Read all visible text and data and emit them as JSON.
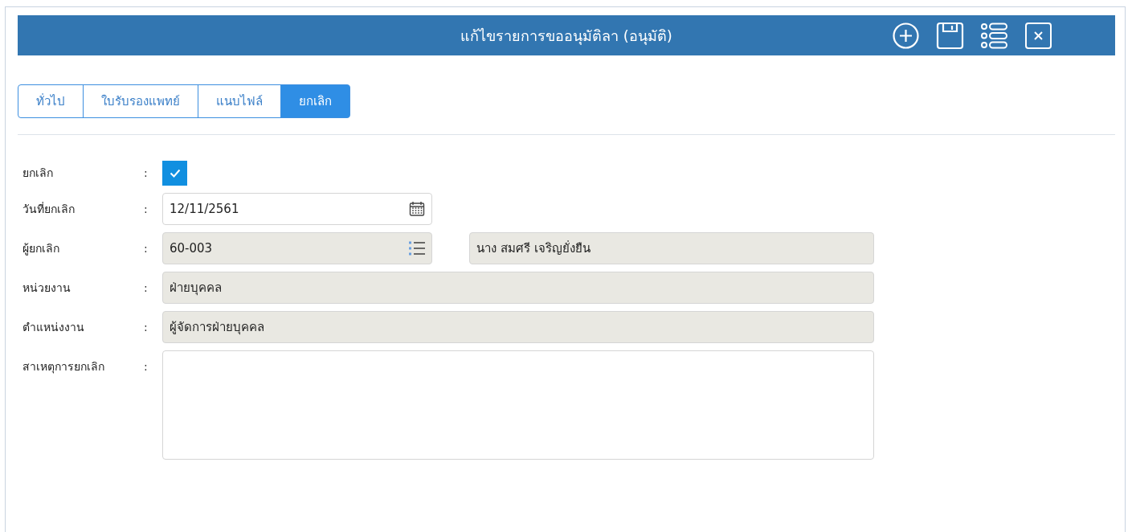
{
  "window": {
    "title": "แก้ไขรายการขออนุมัติลา (อนุมัติ)"
  },
  "tabs": [
    {
      "label": "ทั่วไป",
      "selected": false
    },
    {
      "label": "ใบรับรองแพทย์",
      "selected": false
    },
    {
      "label": "แนบไฟล์",
      "selected": false
    },
    {
      "label": "ยกเลิก",
      "selected": true
    }
  ],
  "fields": [
    {
      "kind": "checkbox",
      "label": "ยกเลิก",
      "separator": ":",
      "checked": true
    },
    {
      "kind": "date",
      "label": "วันที่ยกเลิก",
      "separator": ":",
      "value": "12/11/2561",
      "readonly": false
    },
    {
      "kind": "lookup",
      "label": "ผู้ยกเลิก",
      "separator": ":",
      "value": "60-003",
      "readonly": true,
      "display": "นาง สมศรี เจริญยั่งยืน"
    },
    {
      "kind": "text",
      "label": "หน่วยงาน",
      "separator": ":",
      "value": "ฝ่ายบุคคล",
      "readonly": true
    },
    {
      "kind": "text",
      "label": "ตำแหน่งงาน",
      "separator": ":",
      "value": "ผู้จัดการฝ่ายบุคคล",
      "readonly": true
    },
    {
      "kind": "textarea",
      "label": "สาเหตุการยกเลิก",
      "separator": ":",
      "readonly": false
    }
  ]
}
